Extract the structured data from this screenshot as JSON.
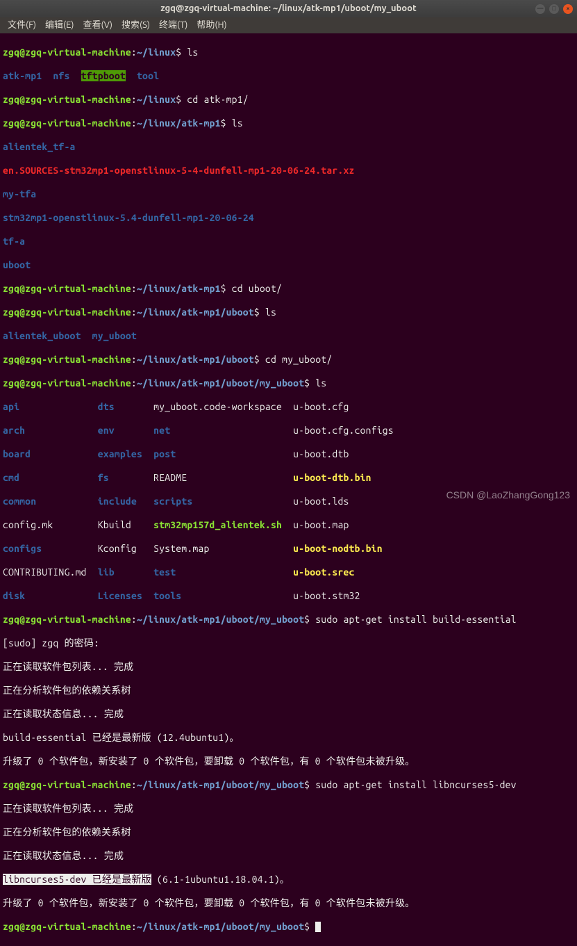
{
  "window": {
    "title": "zgq@zgq-virtual-machine: ~/linux/atk-mp1/uboot/my_uboot"
  },
  "menu": {
    "file": "文件(F)",
    "edit": "编辑(E)",
    "view": "查看(V)",
    "search": "搜索(S)",
    "terminal": "终端(T)",
    "help": "帮助(H)"
  },
  "prompts": {
    "userhost": "zgq@zgq-virtual-machine",
    "path0": "~/linux",
    "path1": "~/linux/atk-mp1",
    "path2": "~/linux/atk-mp1/uboot",
    "path3": "~/linux/atk-mp1/uboot/my_uboot",
    "dollar": "$"
  },
  "cmds": {
    "ls": "ls",
    "cd_atk": "cd atk-mp1/",
    "cd_uboot": "cd uboot/",
    "cd_myuboot": "cd my_uboot/",
    "apt_be": "sudo apt-get install build-essential",
    "apt_nc": "sudo apt-get install libncurses5-dev"
  },
  "ls_linux": {
    "atkmp1": "atk-mp1",
    "nfs": "nfs",
    "tftpboot": "tftpboot",
    "tool": "tool"
  },
  "ls_atk": {
    "alientek_tfa": "alientek_tf-a",
    "en_sources": "en.SOURCES-stm32mp1-openstlinux-5-4-dunfell-mp1-20-06-24.tar.xz",
    "mytfa": "my-tfa",
    "stm32": "stm32mp1-openstlinux-5.4-dunfell-mp1-20-06-24",
    "tfa": "tf-a",
    "uboot": "uboot"
  },
  "ls_uboot": {
    "alientek_uboot": "alientek_uboot",
    "my_uboot": "my_uboot"
  },
  "ls_my": {
    "r0": {
      "c0": "api",
      "c1": "dts",
      "c2": "my_uboot.code-workspace",
      "c3": "u-boot.cfg"
    },
    "r1": {
      "c0": "arch",
      "c1": "env",
      "c2": "net",
      "c3": "u-boot.cfg.configs"
    },
    "r2": {
      "c0": "board",
      "c1": "examples",
      "c2": "post",
      "c3": "u-boot.dtb"
    },
    "r3": {
      "c0": "cmd",
      "c1": "fs",
      "c2": "README",
      "c3": "u-boot-dtb.bin"
    },
    "r4": {
      "c0": "common",
      "c1": "include",
      "c2": "scripts",
      "c3": "u-boot.lds"
    },
    "r5": {
      "c0": "config.mk",
      "c1": "Kbuild",
      "c2": "stm32mp157d_alientek.sh",
      "c3": "u-boot.map"
    },
    "r6": {
      "c0": "configs",
      "c1": "Kconfig",
      "c2": "System.map",
      "c3": "u-boot-nodtb.bin"
    },
    "r7": {
      "c0": "CONTRIBUTING.md",
      "c1": "lib",
      "c2": "test",
      "c3": "u-boot.srec"
    },
    "r8": {
      "c0": "disk",
      "c1": "Licenses",
      "c2": "tools",
      "c3": "u-boot.stm32"
    }
  },
  "apt": {
    "sudo_pw": "[sudo] zgq 的密码:",
    "reading_list": "正在读取软件包列表... 完成",
    "analyze_tree": "正在分析软件包的依赖关系树",
    "reading_state": "正在读取状态信息... 完成",
    "be_latest": "build-essential 已经是最新版 (12.4ubuntu1)。",
    "upgrade_line": "升级了 0 个软件包，新安装了 0 个软件包，要卸载 0 个软件包，有 0 个软件包未被升级。",
    "nc_name": "libncurses5-dev",
    "nc_latest_mid": " 已经是最新版",
    "nc_ver": " (6.1-1ubuntu1.18.04.1)。"
  },
  "watermark": "CSDN @LaoZhangGong123"
}
